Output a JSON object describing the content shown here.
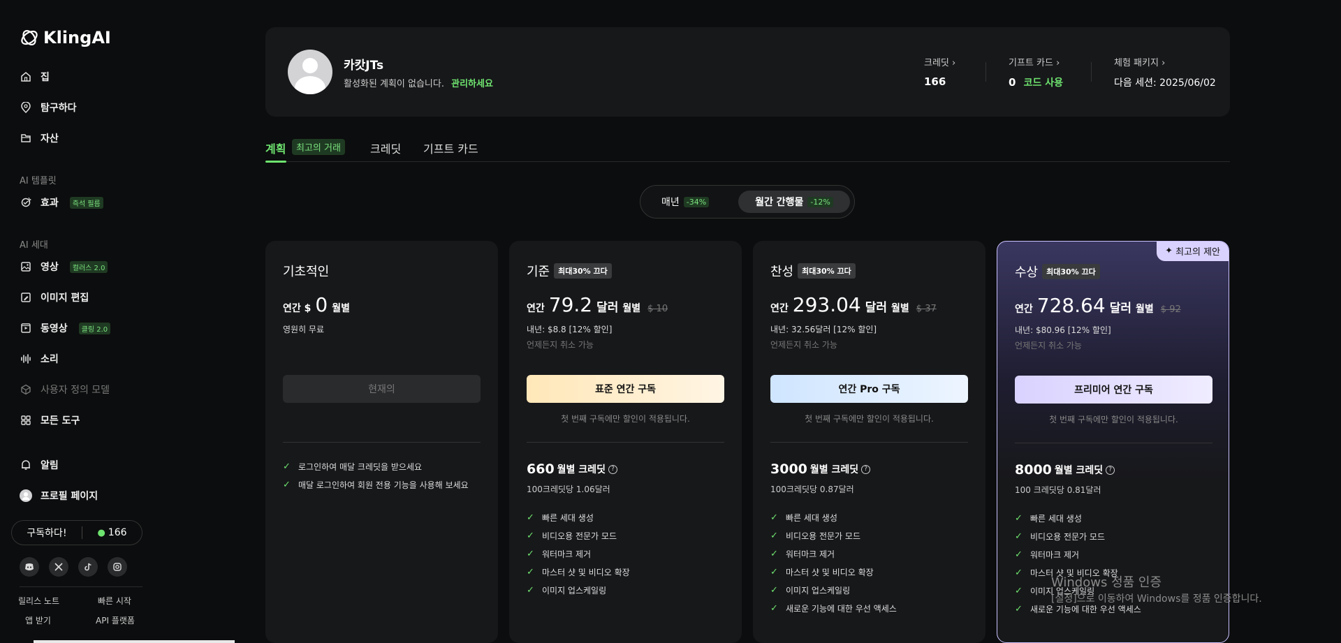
{
  "brand": {
    "name": "KlingAI"
  },
  "sidebar": {
    "nav": [
      {
        "label": "집",
        "icon": "home-icon"
      },
      {
        "label": "탐구하다",
        "icon": "explore-icon"
      },
      {
        "label": "자산",
        "icon": "folder-icon"
      }
    ],
    "section_templates": "AI 템플릿",
    "effects": {
      "label": "효과",
      "tag": "즉석 필름"
    },
    "section_generate": "AI 세대",
    "gen_items": [
      {
        "label": "영상",
        "tag": "컬러스 2.0"
      },
      {
        "label": "이미지 편집",
        "tag": ""
      },
      {
        "label": "동영상",
        "tag": "클링 2.0"
      },
      {
        "label": "소리",
        "tag": ""
      },
      {
        "label": "사용자 정의 모델",
        "tag": ""
      },
      {
        "label": "모든 도구",
        "tag": ""
      }
    ],
    "notifications": "알림",
    "profile": "프로필 페이지",
    "subscribe": "구독하다!",
    "credits": "166",
    "footer": {
      "release_notes": "릴리스 노트",
      "quick_start": "빠른 시작",
      "get_app": "앱 받기",
      "api": "API 플랫폼"
    }
  },
  "profile": {
    "name": "카캇JTs",
    "plan_status": "활성화된 계획이 없습니다.",
    "manage": "관리하세요",
    "credits_label": "크레딧 ›",
    "credits_value": "166",
    "gift_label": "기프트 카드 ›",
    "gift_value": "0",
    "gift_action": "코드 사용",
    "trial_label": "체험 패키지 ›",
    "trial_value": "다음 세션: 2025/06/02"
  },
  "tabs": {
    "plans": "계획",
    "plans_badge": "최고의 거래",
    "credits": "크레딧",
    "gift": "기프트 카드"
  },
  "billing": {
    "annual": "매년",
    "annual_badge": "-34%",
    "monthly": "월간 간행물",
    "monthly_badge": "-12%"
  },
  "plans": [
    {
      "title": "기초적인",
      "badge": "",
      "price_prefix": "연간 $",
      "price": "0",
      "price_unit": "",
      "period": "월별",
      "strike": "",
      "sub": "영원히 무료",
      "sub2": "",
      "cta": "현재의",
      "cta_note": "",
      "credits": "",
      "credits_label": "",
      "credits_per": "",
      "features": [
        "로그인하여 매달 크레딧을 받으세요",
        "매달 로그인하여 회원 전용 기능을 사용해 보세요"
      ]
    },
    {
      "title": "기준",
      "badge": "최대30% 끄다",
      "price_prefix": "연간",
      "price": "79.2",
      "price_unit": "달러",
      "period": "월별",
      "strike": "$ 10",
      "sub": "내년: $8.8  [12% 할인]",
      "sub2": "언제든지 취소 가능",
      "cta": "표준 연간 구독",
      "cta_note": "첫 번째 구독에만 할인이 적용됩니다.",
      "credits": "660",
      "credits_label": "월별 크레딧",
      "credits_per": "100크레딧당 1.06달러",
      "features": [
        "빠른 세대 생성",
        "비디오용 전문가 모드",
        "워터마크 제거",
        "마스터 샷 및 비디오 확장",
        "이미지 업스케일링"
      ]
    },
    {
      "title": "찬성",
      "badge": "최대30% 끄다",
      "price_prefix": "연간",
      "price": "293.04",
      "price_unit": "달러",
      "period": "월별",
      "strike": "$ 37",
      "sub": "내년: 32.56달러  [12% 할인]",
      "sub2": "언제든지 취소 가능",
      "cta": "연간 Pro 구독",
      "cta_note": "첫 번째 구독에만 할인이 적용됩니다.",
      "credits": "3000",
      "credits_label": "월별 크레딧",
      "credits_per": "100크레딧당 0.87달러",
      "features": [
        "빠른 세대 생성",
        "비디오용 전문가 모드",
        "워터마크 제거",
        "마스터 샷 및 비디오 확장",
        "이미지 업스케일링",
        "새로운 기능에 대한 우선 액세스"
      ]
    },
    {
      "title": "수상",
      "badge": "최대30% 끄다",
      "price_prefix": "연간",
      "price": "728.64",
      "price_unit": "달러",
      "period": "월별",
      "strike": "$ 92",
      "sub": "내년: $80.96  [12% 할인]",
      "sub2": "언제든지 취소 가능",
      "cta": "프리미어 연간 구독",
      "cta_note": "첫 번째 구독에만 할인이 적용됩니다.",
      "credits": "8000",
      "credits_label": "월별 크레딧",
      "credits_per": "100 크레딧당 0.81달러",
      "features": [
        "빠른 세대 생성",
        "비디오용 전문가 모드",
        "워터마크 제거",
        "마스터 샷 및 비디오 확장",
        "이미지 업스케일링",
        "새로운 기능에 대한 우선 액세스"
      ],
      "ribbon": "최고의 제안"
    }
  ],
  "watermark": {
    "line1": "Windows 정품 인증",
    "line2": "[설정]으로 이동하여 Windows를 정품 인증합니다."
  }
}
